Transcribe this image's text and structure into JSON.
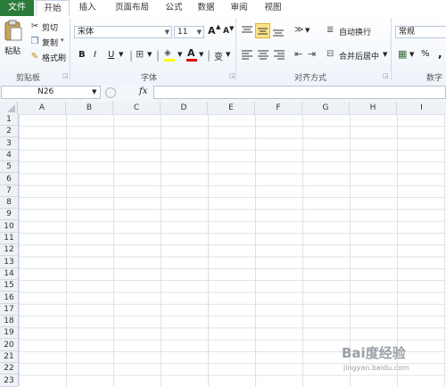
{
  "tabs": [
    {
      "label": "文件",
      "file": true
    },
    {
      "label": "开始",
      "active": true
    },
    {
      "label": "插入"
    },
    {
      "label": "页面布局"
    },
    {
      "label": "公式"
    },
    {
      "label": "数据"
    },
    {
      "label": "审阅"
    },
    {
      "label": "视图"
    }
  ],
  "clipboard": {
    "paste": "粘贴",
    "cut": "剪切",
    "copy": "复制",
    "format_painter": "格式刷",
    "group": "剪贴板"
  },
  "font": {
    "name": "宋体",
    "size": "11",
    "grow": "A",
    "shrink": "A",
    "bold": "B",
    "italic": "I",
    "underline": "U",
    "font_color": "A",
    "phonetic": "变",
    "group": "字体"
  },
  "alignment": {
    "wrap": "自动换行",
    "merge": "合并后居中",
    "group": "对齐方式"
  },
  "number": {
    "format": "常规",
    "percent": "%",
    "comma": ",",
    "group": "数字"
  },
  "formula_bar": {
    "name_box": "N26",
    "fx": "fx",
    "formula": ""
  },
  "columns": [
    "A",
    "B",
    "C",
    "D",
    "E",
    "F",
    "G",
    "H",
    "I"
  ],
  "rows": [
    "1",
    "2",
    "3",
    "4",
    "5",
    "6",
    "7",
    "8",
    "9",
    "10",
    "11",
    "12",
    "13",
    "14",
    "15",
    "16",
    "17",
    "18",
    "19",
    "20",
    "21",
    "22",
    "23"
  ],
  "watermark": {
    "line1": "Bai度经验",
    "line2": "jingyan.baidu.com"
  }
}
